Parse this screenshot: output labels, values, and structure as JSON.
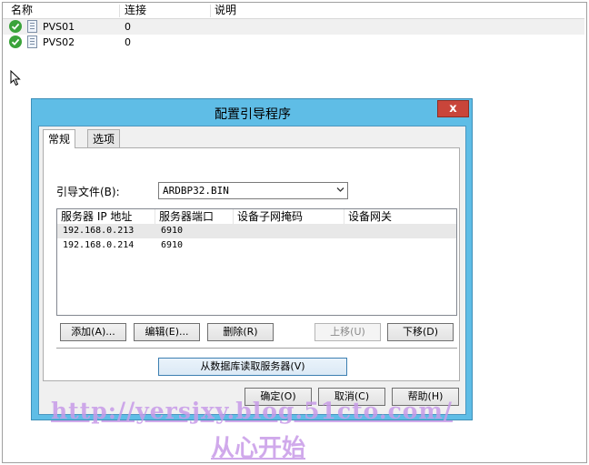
{
  "list": {
    "columns": [
      "名称",
      "连接",
      "说明"
    ],
    "rows": [
      {
        "name": "PVS01",
        "connections": "0",
        "description": ""
      },
      {
        "name": "PVS02",
        "connections": "0",
        "description": ""
      }
    ]
  },
  "dialog": {
    "title": "配置引导程序",
    "close_label": "x",
    "tabs": [
      "常规",
      "选项"
    ],
    "bootfile_label": "引导文件(B):",
    "bootfile_value": "ARDBP32.BIN",
    "table": {
      "columns": [
        "服务器 IP 地址",
        "服务器端口",
        "设备子网掩码",
        "设备网关"
      ],
      "rows": [
        {
          "ip": "192.168.0.213",
          "port": "6910",
          "mask": "",
          "gateway": ""
        },
        {
          "ip": "192.168.0.214",
          "port": "6910",
          "mask": "",
          "gateway": ""
        }
      ]
    },
    "buttons": {
      "add": "添加(A)...",
      "edit": "编辑(E)...",
      "delete": "删除(R)",
      "move_up": "上移(U)",
      "move_down": "下移(D)",
      "read_db": "从数据库读取服务器(V)",
      "ok": "确定(O)",
      "cancel": "取消(C)",
      "help": "帮助(H)"
    }
  },
  "watermark": {
    "url": "http://yersjxy.blog.51cto.com/",
    "text": "从心开始"
  },
  "colors": {
    "dialog_frame": "#5fbde6",
    "close_button": "#c9453a",
    "status_ok": "#3aa33a",
    "watermark": "#c89be8"
  }
}
